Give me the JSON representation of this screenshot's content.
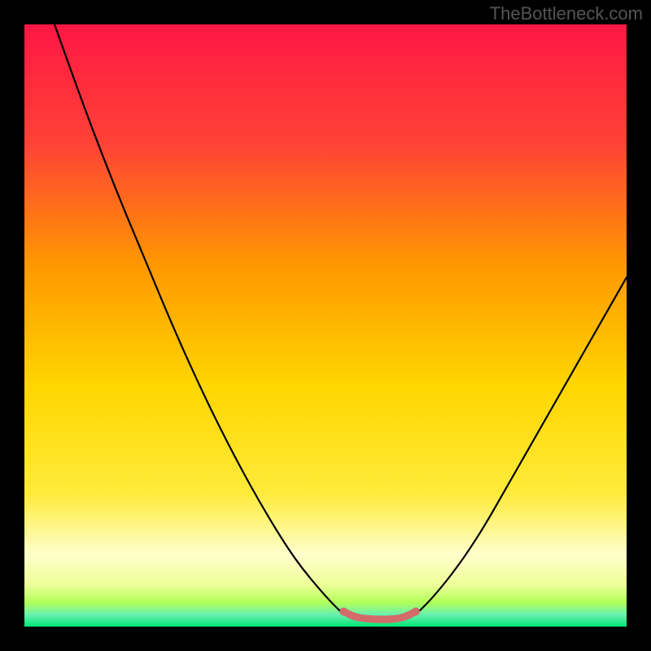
{
  "watermark": "TheBottleneck.com",
  "chart_data": {
    "type": "line",
    "title": "",
    "xlabel": "",
    "ylabel": "",
    "xlim": [
      0,
      100
    ],
    "ylim": [
      0,
      100
    ],
    "gradient_stops": [
      {
        "offset": 0,
        "color": "#ff1744"
      },
      {
        "offset": 20,
        "color": "#ff4336"
      },
      {
        "offset": 40,
        "color": "#ff9800"
      },
      {
        "offset": 60,
        "color": "#ffd600"
      },
      {
        "offset": 78,
        "color": "#ffeb3b"
      },
      {
        "offset": 88,
        "color": "#ffffcc"
      },
      {
        "offset": 93,
        "color": "#eeff99"
      },
      {
        "offset": 96,
        "color": "#b2ff59"
      },
      {
        "offset": 98,
        "color": "#69f0ae"
      },
      {
        "offset": 100,
        "color": "#00e676"
      }
    ],
    "series": [
      {
        "name": "left-curve",
        "color": "#000000",
        "points": [
          {
            "x": 5,
            "y": 100
          },
          {
            "x": 10,
            "y": 86
          },
          {
            "x": 15,
            "y": 73
          },
          {
            "x": 20,
            "y": 61
          },
          {
            "x": 25,
            "y": 49
          },
          {
            "x": 30,
            "y": 38
          },
          {
            "x": 35,
            "y": 28
          },
          {
            "x": 40,
            "y": 19
          },
          {
            "x": 45,
            "y": 11
          },
          {
            "x": 50,
            "y": 5
          },
          {
            "x": 53,
            "y": 2
          }
        ]
      },
      {
        "name": "right-curve",
        "color": "#000000",
        "points": [
          {
            "x": 65,
            "y": 2
          },
          {
            "x": 68,
            "y": 5
          },
          {
            "x": 72,
            "y": 10
          },
          {
            "x": 76,
            "y": 16
          },
          {
            "x": 80,
            "y": 23
          },
          {
            "x": 84,
            "y": 30
          },
          {
            "x": 88,
            "y": 37
          },
          {
            "x": 92,
            "y": 44
          },
          {
            "x": 96,
            "y": 51
          },
          {
            "x": 100,
            "y": 58
          }
        ]
      },
      {
        "name": "bottom-red-segment",
        "color": "#d46a6a",
        "thick": true,
        "points": [
          {
            "x": 53,
            "y": 2.5
          },
          {
            "x": 55,
            "y": 1.5
          },
          {
            "x": 58,
            "y": 1.2
          },
          {
            "x": 61,
            "y": 1.2
          },
          {
            "x": 63,
            "y": 1.5
          },
          {
            "x": 65,
            "y": 2.5
          }
        ]
      }
    ]
  }
}
